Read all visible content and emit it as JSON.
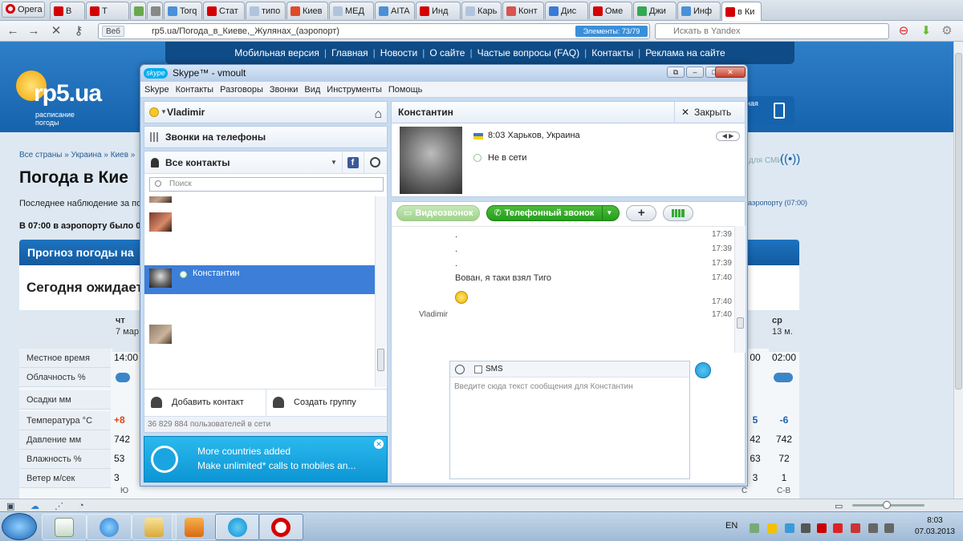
{
  "browser": {
    "opera_button": "Opera",
    "tabs": [
      {
        "label": "В",
        "color": "#d40000"
      },
      {
        "label": "Т",
        "color": "#d40000"
      },
      {
        "label": "",
        "color": "#6aa84f"
      },
      {
        "label": "",
        "color": "#888888"
      },
      {
        "label": "Torq",
        "color": "#4a90d9"
      },
      {
        "label": "Стат",
        "color": "#d40000"
      },
      {
        "label": "типо",
        "color": "#b0c4de"
      },
      {
        "label": "Киев",
        "color": "#e04a2a"
      },
      {
        "label": "МЕД",
        "color": "#b0c4de"
      },
      {
        "label": "AITA",
        "color": "#4a90d9"
      },
      {
        "label": "Инд",
        "color": "#d40000"
      },
      {
        "label": "Карь",
        "color": "#b0c4de"
      },
      {
        "label": "Конт",
        "color": "#d9534f"
      },
      {
        "label": "Дис",
        "color": "#3a7bd5"
      },
      {
        "label": "Оме",
        "color": "#d40000"
      },
      {
        "label": "Джи",
        "color": "#34a853"
      },
      {
        "label": "Инф",
        "color": "#4a90d9"
      },
      {
        "label": "в Ки",
        "color": "#d40000"
      }
    ],
    "web_badge": "Веб",
    "url": "rp5.ua/Погода_в_Киеве,_Жулянах_(аэропорт)",
    "elements_badge": "Элементы: 73/79",
    "search_placeholder": "Искать в Yandex"
  },
  "site": {
    "nav": [
      "Мобильная версия",
      "Главная",
      "Новости",
      "О сайте",
      "Частые вопросы (FAQ)",
      "Контакты",
      "Реклама на сайте"
    ],
    "logo": "rp5.ua",
    "logo_sub": "расписание погоды",
    "breadcrumb": "Все страны » Украина » Киев »",
    "title": "Погода в Кие",
    "last_obs": "Последнее наблюдение за по",
    "obs_7": "В 07:00 в аэропорту было 0",
    "forecast_head": "Прогноз погоды на",
    "today": "Сегодня ожидает",
    "smi": "для СМИ",
    "aero_link": "аэропорту (07:00)",
    "mobile_snip": "ная",
    "days": [
      {
        "d": "чт",
        "sub": "7 мар"
      },
      {
        "d": "ср",
        "sub": "13 м."
      }
    ],
    "rows": [
      {
        "label": "Местное время",
        "left": "14:00",
        "right1": "00",
        "right2": "02:00"
      },
      {
        "label": "Облачность %",
        "left": "",
        "right1": "",
        "right2": ""
      },
      {
        "label": "Осадки мм",
        "left": "",
        "right1": "",
        "right2": ""
      },
      {
        "label": "Температура °C",
        "left": "+8",
        "right1": "5",
        "right2": "-6"
      },
      {
        "label": "Давление мм",
        "left": "742",
        "right1": "42",
        "right2": "742"
      },
      {
        "label": "Влажность %",
        "left": "53",
        "right1": "63",
        "right2": "72"
      },
      {
        "label": "Ветер м/сек",
        "left": "3",
        "right1": "3",
        "right2": "1"
      }
    ],
    "wind_dirs": [
      "Ю",
      "С",
      "С-В"
    ]
  },
  "skype": {
    "title": "Skype™ - vmoult",
    "logo": "skype",
    "menu": [
      "Skype",
      "Контакты",
      "Разговоры",
      "Звонки",
      "Вид",
      "Инструменты",
      "Помощь"
    ],
    "me": "Vladimir",
    "calls": "Звонки на телефоны",
    "all_contacts": "Все контакты",
    "search_placeholder": "Поиск",
    "selected_contact": "Константин",
    "add_contact": "Добавить контакт",
    "create_group": "Создать группу",
    "users_online": "36 829 884 пользователей в сети",
    "promo_title": "More countries added",
    "promo_text": "Make unlimited* calls to mobiles an...",
    "conv_name": "Константин",
    "close": "Закрыть",
    "location": "8:03 Харьков, Украина",
    "status": "Не в сети",
    "video_call": "Видеозвонок",
    "phone_call": "Телефонный звонок",
    "messages": [
      {
        "name": "",
        "text": ".",
        "time": "17:39"
      },
      {
        "name": "",
        "text": ".",
        "time": "17:39"
      },
      {
        "name": "",
        "text": ".",
        "time": "17:39"
      },
      {
        "name": "",
        "text": "Вован, я таки взял Тиго",
        "time": "17:40"
      },
      {
        "name": "",
        "text": "",
        "time": "17:40"
      },
      {
        "name": "Vladimir",
        "text": "",
        "time": "17:40"
      }
    ],
    "sms": "SMS",
    "compose_placeholder": "Введите сюда текст сообщения для Константин"
  },
  "taskbar": {
    "lang": "EN",
    "time": "8:03",
    "date": "07.03.2013"
  }
}
